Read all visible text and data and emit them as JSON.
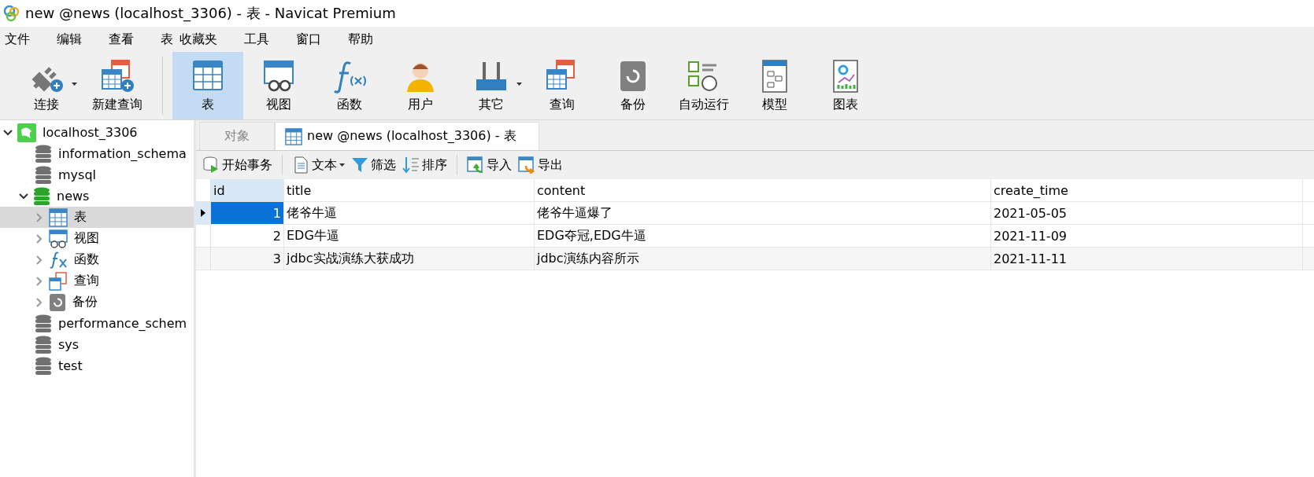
{
  "window": {
    "title": "new @news (localhost_3306) - 表 - Navicat Premium"
  },
  "menu": [
    "文件",
    "编辑",
    "查看",
    "表",
    "收藏夹",
    "工具",
    "窗口",
    "帮助"
  ],
  "toolbar": [
    [
      {
        "label": "连接",
        "selected": false,
        "dropdown": true
      },
      {
        "label": "新建查询",
        "selected": false,
        "dropdown": false
      }
    ],
    [
      {
        "label": "表",
        "selected": true,
        "dropdown": false
      },
      {
        "label": "视图",
        "selected": false,
        "dropdown": false
      },
      {
        "label": "函数",
        "selected": false,
        "dropdown": false
      },
      {
        "label": "用户",
        "selected": false,
        "dropdown": false
      },
      {
        "label": "其它",
        "selected": false,
        "dropdown": true
      },
      {
        "label": "查询",
        "selected": false,
        "dropdown": false
      },
      {
        "label": "备份",
        "selected": false,
        "dropdown": false
      },
      {
        "label": "自动运行",
        "selected": false,
        "dropdown": false
      },
      {
        "label": "模型",
        "selected": false,
        "dropdown": false
      },
      {
        "label": "图表",
        "selected": false,
        "dropdown": false
      }
    ]
  ],
  "sidebar": {
    "tree": [
      {
        "label": "localhost_3306",
        "kind": "server",
        "expanded": true,
        "selected": false,
        "children": [
          {
            "label": "information_schema",
            "kind": "database",
            "expanded": false,
            "selected": false
          },
          {
            "label": "mysql",
            "kind": "database",
            "expanded": false,
            "selected": false
          },
          {
            "label": "news",
            "kind": "database",
            "expanded": true,
            "selected": false,
            "children": [
              {
                "label": "表",
                "kind": "tables",
                "expanded": false,
                "selected": true
              },
              {
                "label": "视图",
                "kind": "views",
                "expanded": false,
                "selected": false
              },
              {
                "label": "函数",
                "kind": "functions",
                "expanded": false,
                "selected": false
              },
              {
                "label": "查询",
                "kind": "queries",
                "expanded": false,
                "selected": false
              },
              {
                "label": "备份",
                "kind": "backups",
                "expanded": false,
                "selected": false
              }
            ]
          },
          {
            "label": "performance_schem",
            "kind": "database",
            "expanded": false,
            "selected": false
          },
          {
            "label": "sys",
            "kind": "database",
            "expanded": false,
            "selected": false
          },
          {
            "label": "test",
            "kind": "database",
            "expanded": false,
            "selected": false
          }
        ]
      }
    ]
  },
  "tabs": [
    {
      "label": "对象",
      "selected": false,
      "kind": "plain"
    },
    {
      "label": "new @news (localhost_3306) - 表",
      "selected": true,
      "kind": "table"
    }
  ],
  "table_toolbar": [
    [
      {
        "label": "开始事务",
        "dropdown": false
      }
    ],
    [
      {
        "label": "文本",
        "dropdown": true
      },
      {
        "label": "筛选",
        "dropdown": false
      },
      {
        "label": "排序",
        "dropdown": false
      }
    ],
    [
      {
        "label": "导入",
        "dropdown": false
      },
      {
        "label": "导出",
        "dropdown": false
      }
    ]
  ],
  "table": {
    "columns": [
      {
        "label": "id",
        "selected": true
      },
      {
        "label": "title",
        "selected": false
      },
      {
        "label": "content",
        "selected": false
      },
      {
        "label": "create_time",
        "selected": false
      }
    ],
    "rows": [
      {
        "selected": true,
        "cells": [
          "1",
          "佬爷牛逼",
          "佬爷牛逼爆了",
          "2021-05-05"
        ]
      },
      {
        "selected": false,
        "cells": [
          "2",
          "EDG牛逼",
          "EDG夺冠,EDG牛逼",
          "2021-11-09"
        ]
      },
      {
        "selected": false,
        "cells": [
          "3",
          "jdbc实战演练大获成功",
          "jdbc演练内容所示",
          "2021-11-11"
        ]
      }
    ]
  }
}
